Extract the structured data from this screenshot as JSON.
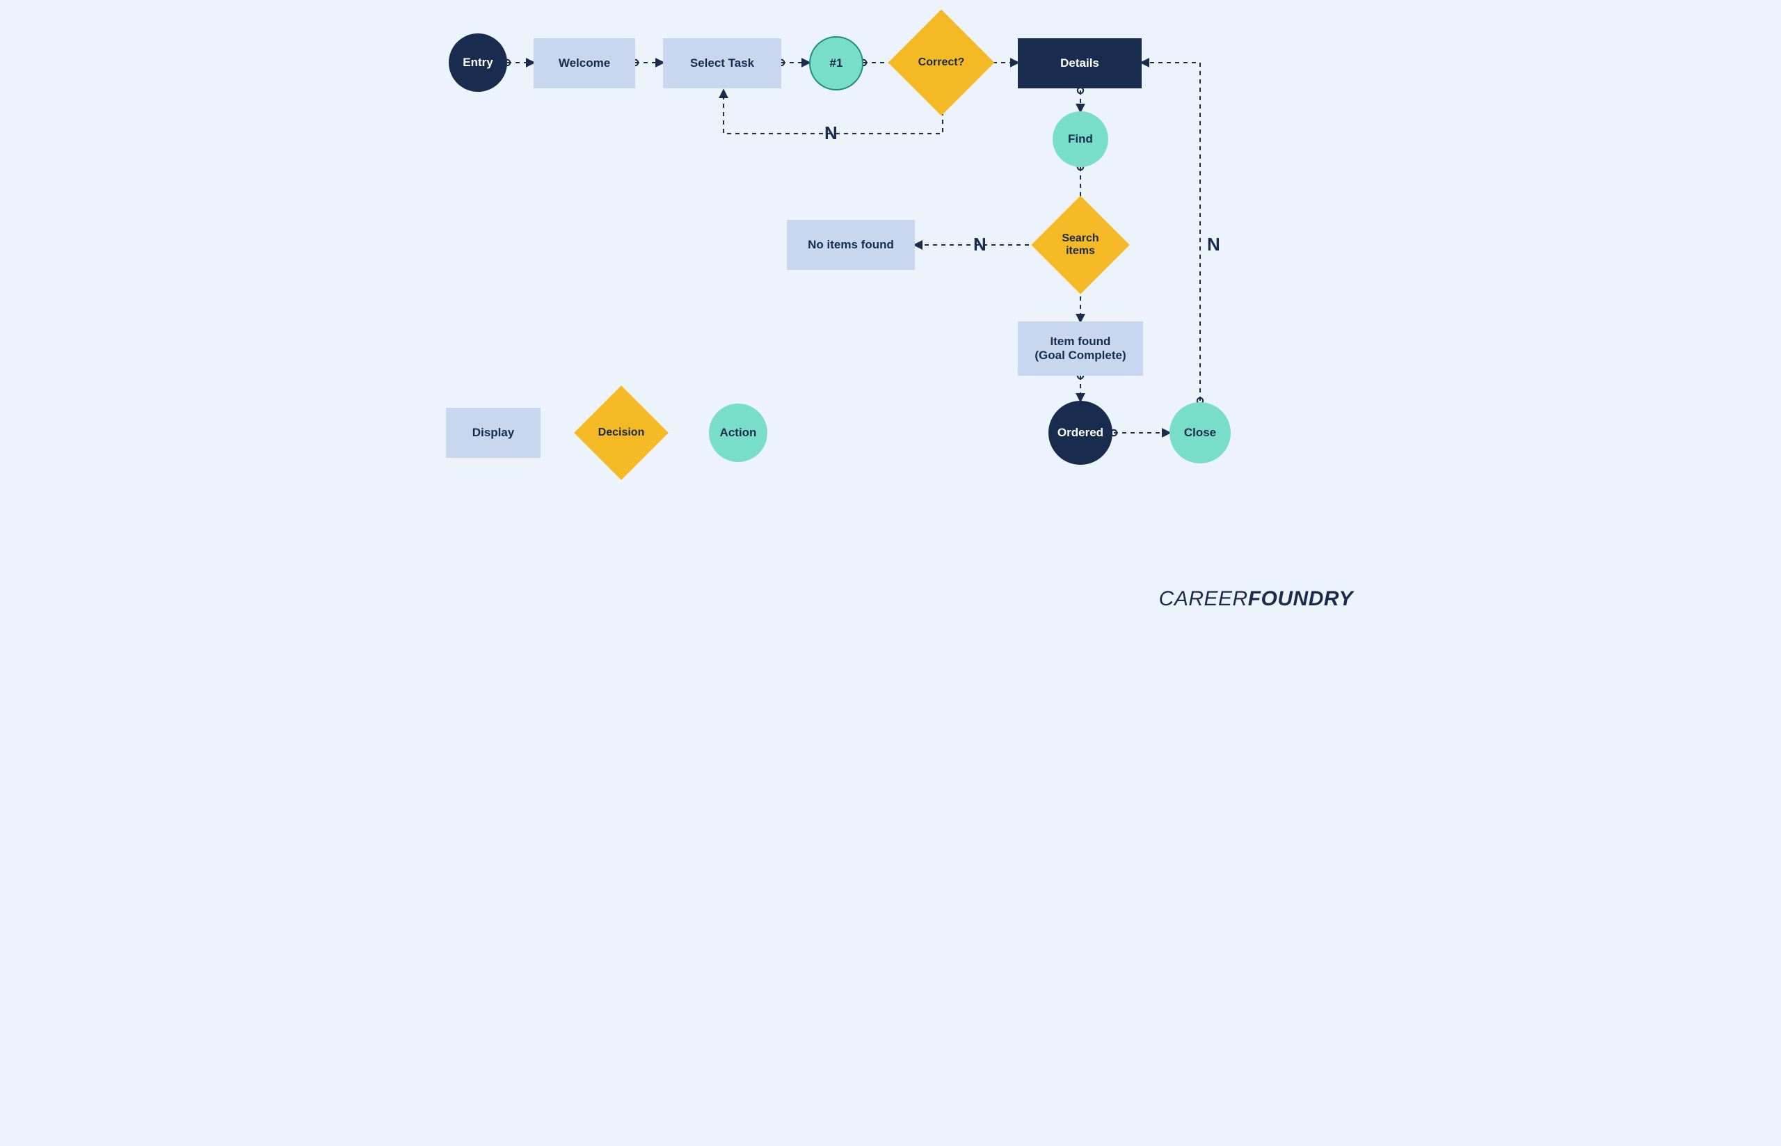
{
  "nodes": {
    "entry": {
      "label": "Entry"
    },
    "welcome": {
      "label": "Welcome"
    },
    "select_task": {
      "label": "Select Task"
    },
    "ref1": {
      "label": "#1"
    },
    "correct": {
      "label": "Correct?"
    },
    "details": {
      "label": "Details"
    },
    "find": {
      "label": "Find"
    },
    "search_items": {
      "label": "Search\nitems"
    },
    "no_items": {
      "label": "No items found"
    },
    "item_found": {
      "label": "Item found\n(Goal Complete)"
    },
    "ordered": {
      "label": "Ordered"
    },
    "close": {
      "label": "Close"
    }
  },
  "edge_labels": {
    "correct_no": "N",
    "search_no": "N",
    "close_no": "N"
  },
  "legend": {
    "display": "Display",
    "decision": "Decision",
    "action": "Action"
  },
  "brand": {
    "part1": "CAREER",
    "part2": "FOUNDRY"
  },
  "colors": {
    "bg": "#ecf3fb",
    "rect_light": "#c8d7ef",
    "rect_dark": "#1a2c4d",
    "teal": "#78dec7",
    "yellow": "#f5b925",
    "text_dark": "#1a2c4d"
  }
}
